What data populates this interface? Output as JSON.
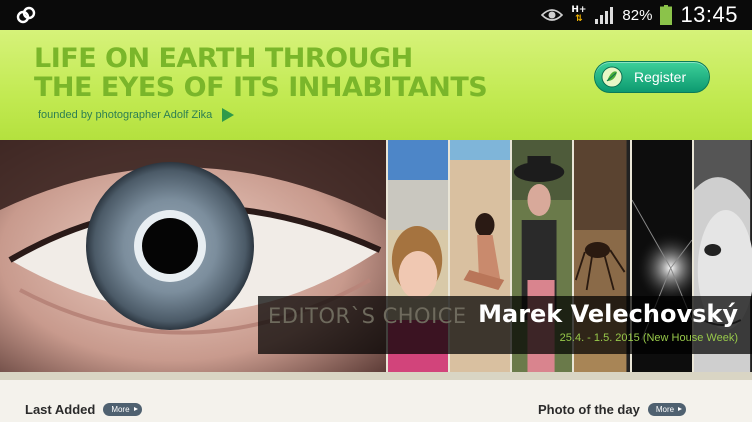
{
  "status_bar": {
    "network_type": "H+",
    "battery_percent": "82%",
    "time": "13:45",
    "icons": [
      "sync-icon",
      "eye-icon",
      "network-arrows-icon",
      "signal-icon",
      "battery-icon"
    ]
  },
  "header": {
    "headline_line1": "LIFE ON EARTH THROUGH",
    "headline_line2": "THE EYES OF ITS INHABITANTS",
    "founded": "founded by photographer Adolf Zika",
    "register_label": "Register"
  },
  "hero": {
    "section_label": "EDITOR`S CHOICE",
    "photographer": "Marek Velechovský",
    "dates": "25.4. - 1.5. 2015 (New House Week)"
  },
  "sections": {
    "last_added": "Last Added",
    "photo_of_day": "Photo of the day",
    "more_label": "More"
  },
  "colors": {
    "header_green": "#c2ea52",
    "headline_green": "#7ab62a",
    "register_teal": "#0d9a70",
    "dates_green": "#97c84a"
  }
}
